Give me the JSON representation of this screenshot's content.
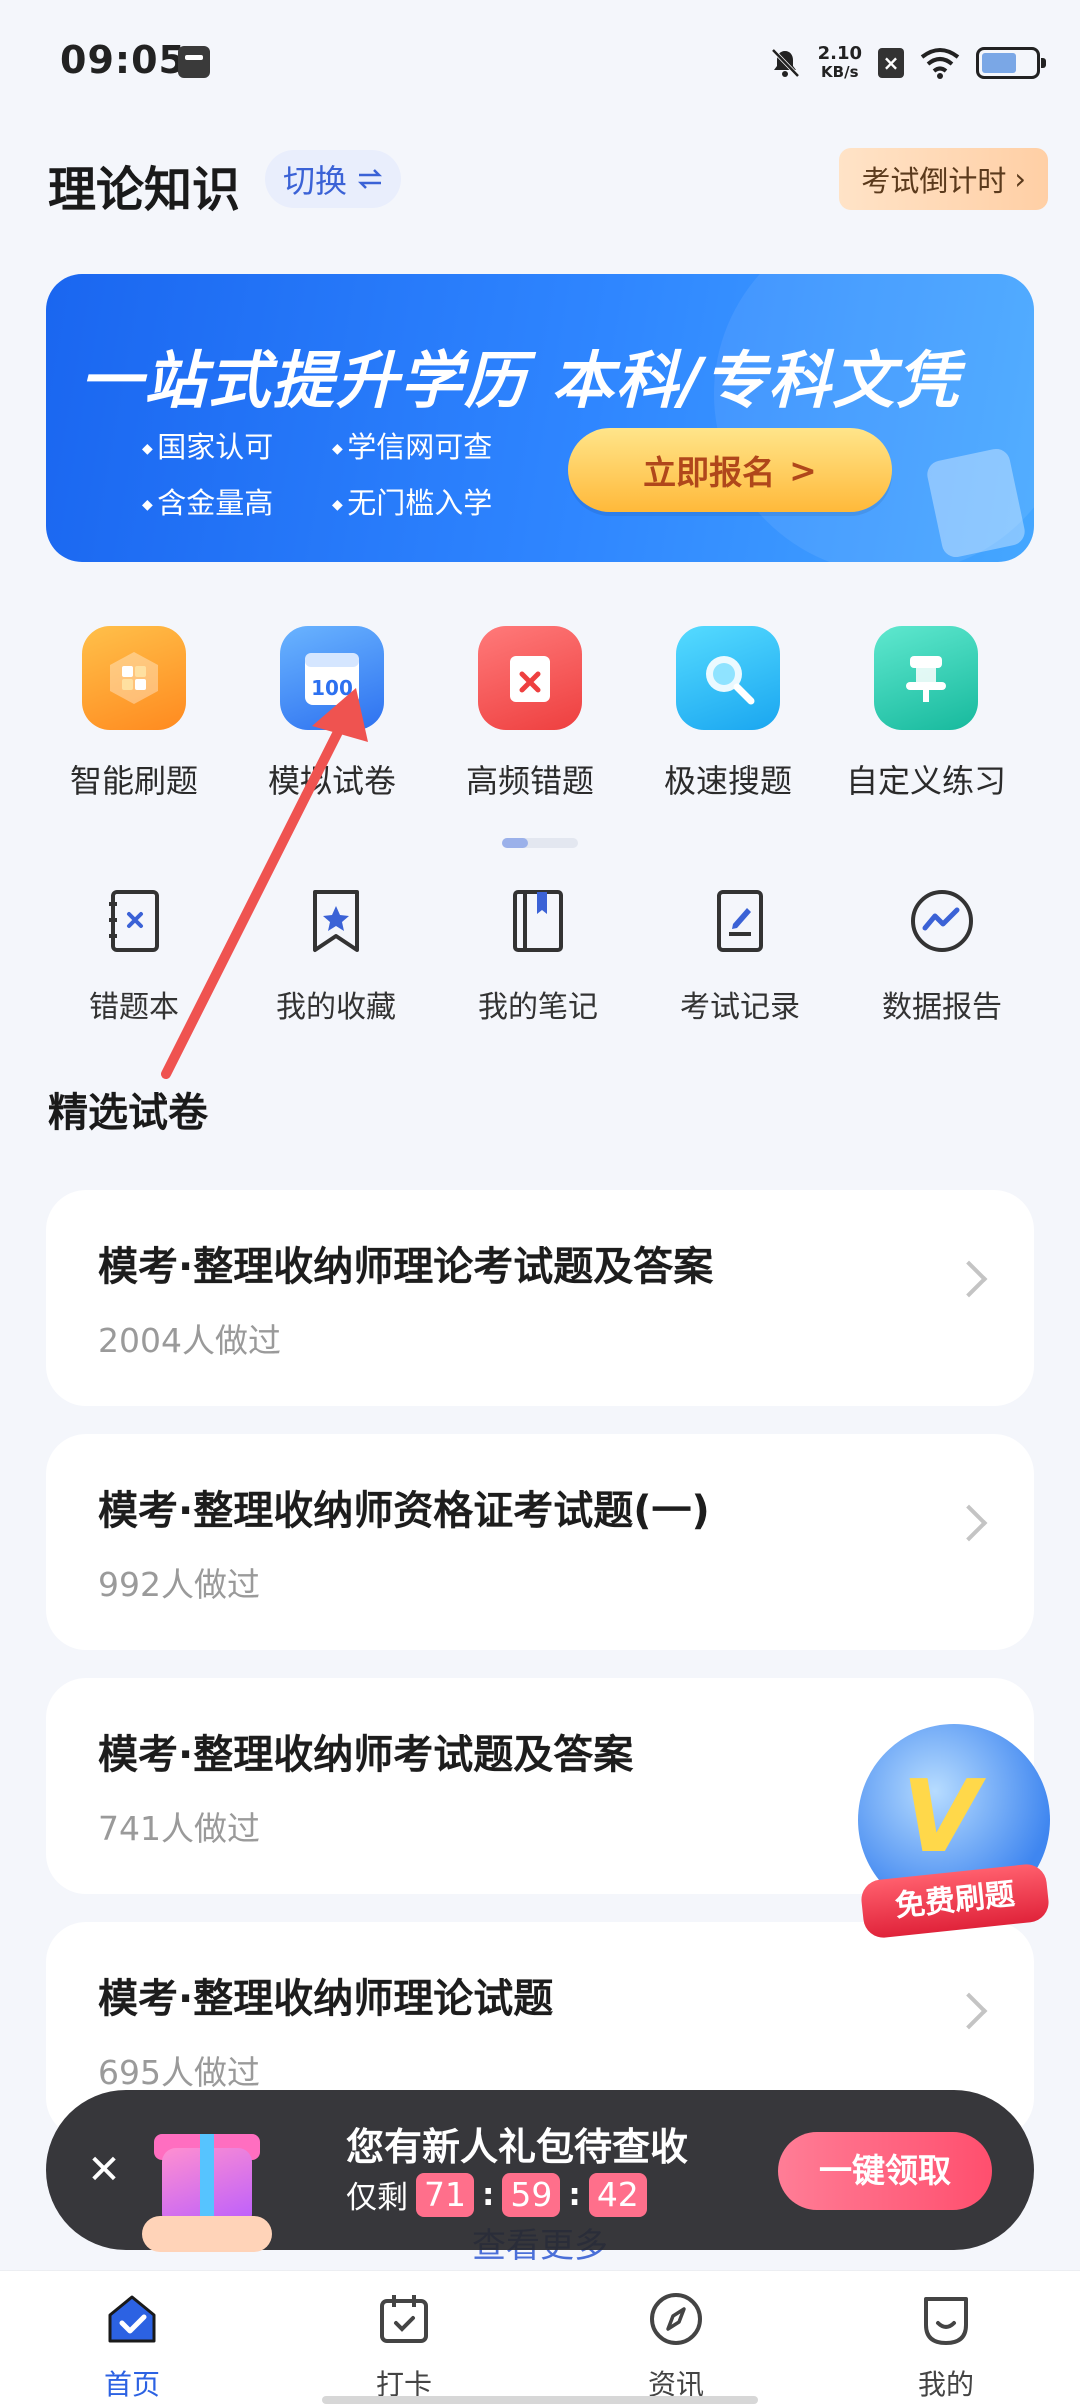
{
  "status_bar": {
    "time": "09:05",
    "net_speed_value": "2.10",
    "net_speed_unit": "KB/s"
  },
  "header": {
    "title": "理论知识",
    "switch_label": "切换",
    "switch_icon": "swap-arrows-icon",
    "countdown_label": "考试倒计时",
    "countdown_chevron": "›"
  },
  "banner": {
    "title": "一站式提升学历 本科/专科文凭",
    "points": [
      "国家认可",
      "学信网可查",
      "含金量高",
      "无门槛入学"
    ],
    "cta": "立即报名",
    "cta_chevron": ">",
    "colors": {
      "from": "#1a66f0",
      "to": "#45a7ff"
    }
  },
  "tools": [
    {
      "label": "智能刷题",
      "icon": "smart-practice-icon"
    },
    {
      "label": "模拟试卷",
      "icon": "mock-exam-icon",
      "icon_text": "100"
    },
    {
      "label": "高频错题",
      "icon": "frequent-mistakes-icon"
    },
    {
      "label": "极速搜题",
      "icon": "quick-search-icon"
    },
    {
      "label": "自定义练习",
      "icon": "custom-practice-icon"
    }
  ],
  "tools_secondary": [
    {
      "label": "错题本",
      "icon": "wrong-book-icon"
    },
    {
      "label": "我的收藏",
      "icon": "favorites-icon"
    },
    {
      "label": "我的笔记",
      "icon": "notes-icon"
    },
    {
      "label": "考试记录",
      "icon": "exam-record-icon"
    },
    {
      "label": "数据报告",
      "icon": "data-report-icon"
    }
  ],
  "featured": {
    "section_title": "精选试卷",
    "papers": [
      {
        "title": "模考·整理收纳师理论考试题及答案",
        "count": "2004人做过"
      },
      {
        "title": "模考·整理收纳师资格证考试题(一)",
        "count": "992人做过"
      },
      {
        "title": "模考·整理收纳师考试题及答案",
        "count": "741人做过"
      },
      {
        "title": "模考·整理收纳师理论试题",
        "count": "695人做过"
      }
    ],
    "view_more": "查看更多"
  },
  "float_badge": {
    "label": "免费刷题",
    "letter": "V"
  },
  "gift_bar": {
    "close": "✕",
    "title": "您有新人礼包待查收",
    "remaining_label": "仅剩",
    "timer": [
      "71",
      "59",
      "42"
    ],
    "cta": "一键领取"
  },
  "bottom_nav": [
    {
      "label": "首页",
      "icon": "home-icon",
      "active": true
    },
    {
      "label": "打卡",
      "icon": "calendar-checkin-icon",
      "active": false
    },
    {
      "label": "资讯",
      "icon": "compass-icon",
      "active": false
    },
    {
      "label": "我的",
      "icon": "profile-icon",
      "active": false
    }
  ],
  "colors": {
    "accent": "#2c62e3",
    "page_bg": "#f4f6fb",
    "tutorial_arrow": "#ef5350"
  }
}
